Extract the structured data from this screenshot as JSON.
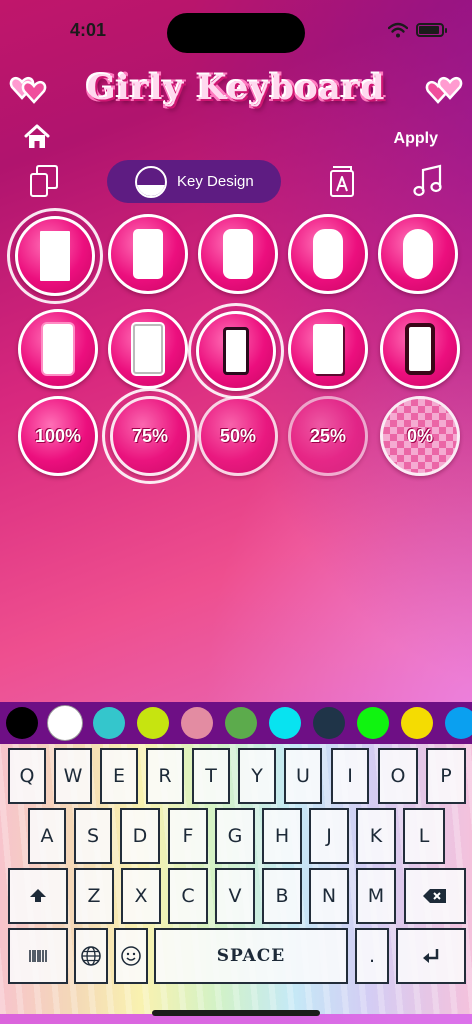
{
  "status_bar": {
    "time": "4:01"
  },
  "header": {
    "title": "Girly Keyboard",
    "apply_label": "Apply"
  },
  "tabs": {
    "items": [
      {
        "icon": "layout-icon"
      },
      {
        "label": "Key Design",
        "icon": "key-design-icon",
        "active": true
      },
      {
        "icon": "font-icon"
      },
      {
        "icon": "music-note-icon"
      }
    ]
  },
  "key_shapes": {
    "row1": [
      "rectangle",
      "rounded-rectangle",
      "rounded-rectangle-2",
      "pill",
      "round-pill"
    ],
    "row2": [
      "framed",
      "double-framed",
      "dark-framed",
      "shadow-framed",
      "dark-bordered"
    ]
  },
  "opacity_options": {
    "labels": [
      "100%",
      "75%",
      "50%",
      "25%",
      "0%"
    ]
  },
  "palette": {
    "colors": [
      "#000000",
      "#ffffff",
      "#34c6cc",
      "#c6e410",
      "#e38ca2",
      "#5cab4c",
      "#08e3f0",
      "#1f3448",
      "#10f410",
      "#f4dc02",
      "#0aa0f0"
    ],
    "selected_index": 1
  },
  "keyboard": {
    "row1": [
      "Q",
      "W",
      "E",
      "R",
      "T",
      "Y",
      "U",
      "I",
      "O",
      "P"
    ],
    "row2": [
      "A",
      "S",
      "D",
      "F",
      "G",
      "H",
      "J",
      "K",
      "L"
    ],
    "row3": [
      "Z",
      "X",
      "C",
      "V",
      "B",
      "N",
      "M"
    ],
    "space_label": "SPACE",
    "period_label": "."
  },
  "accent_color": "#ec0f7e",
  "tab_active_color": "#5e1c82"
}
